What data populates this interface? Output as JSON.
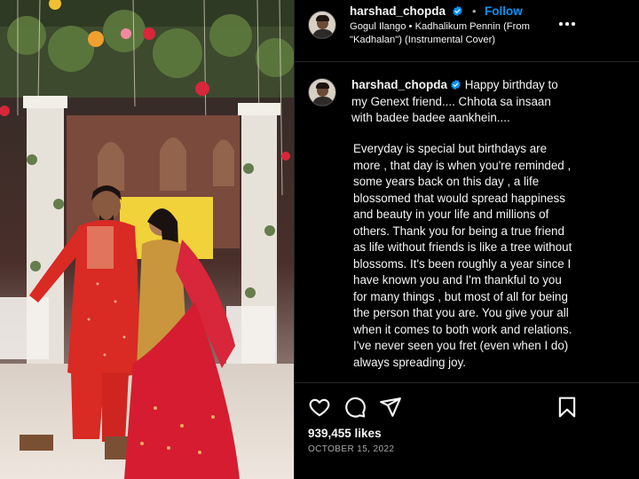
{
  "post": {
    "author": "harshad_chopda",
    "follow_label": "Follow",
    "separator": "•",
    "audio": "Gogul Ilango • Kadhalikum Pennin (From \"Kadhalan\") (Instrumental Cover)",
    "caption_username": "harshad_chopda",
    "caption_first": "Happy birthday to my Genext friend.... Chhota sa insaan with badee badee aankhein....",
    "caption_body": "Everyday is special but birthdays are more , that day is when you're reminded , some years back on this day , a life blossomed that would spread happiness and beauty in your life and millions of others. Thank you for being a true friend as life without friends is like a tree without blossoms. It's been roughly a year since I have known you and I'm thankful to you for many things , but most of all for being the person that you are. You give your all when it comes to both work and relations. I've never seen you fret (even when I do) always spreading joy.",
    "likes": "939,455 likes",
    "date": "OCTOBER 15, 2022"
  },
  "icons": {
    "verified": "verified-badge-icon",
    "more": "more-options-icon",
    "like": "heart-icon",
    "comment": "comment-icon",
    "share": "share-icon",
    "save": "bookmark-icon"
  },
  "colors": {
    "accent": "#0095f6",
    "background": "#000000",
    "text": "#f5f5f5",
    "muted": "#a8a8a8",
    "divider": "#262626"
  }
}
